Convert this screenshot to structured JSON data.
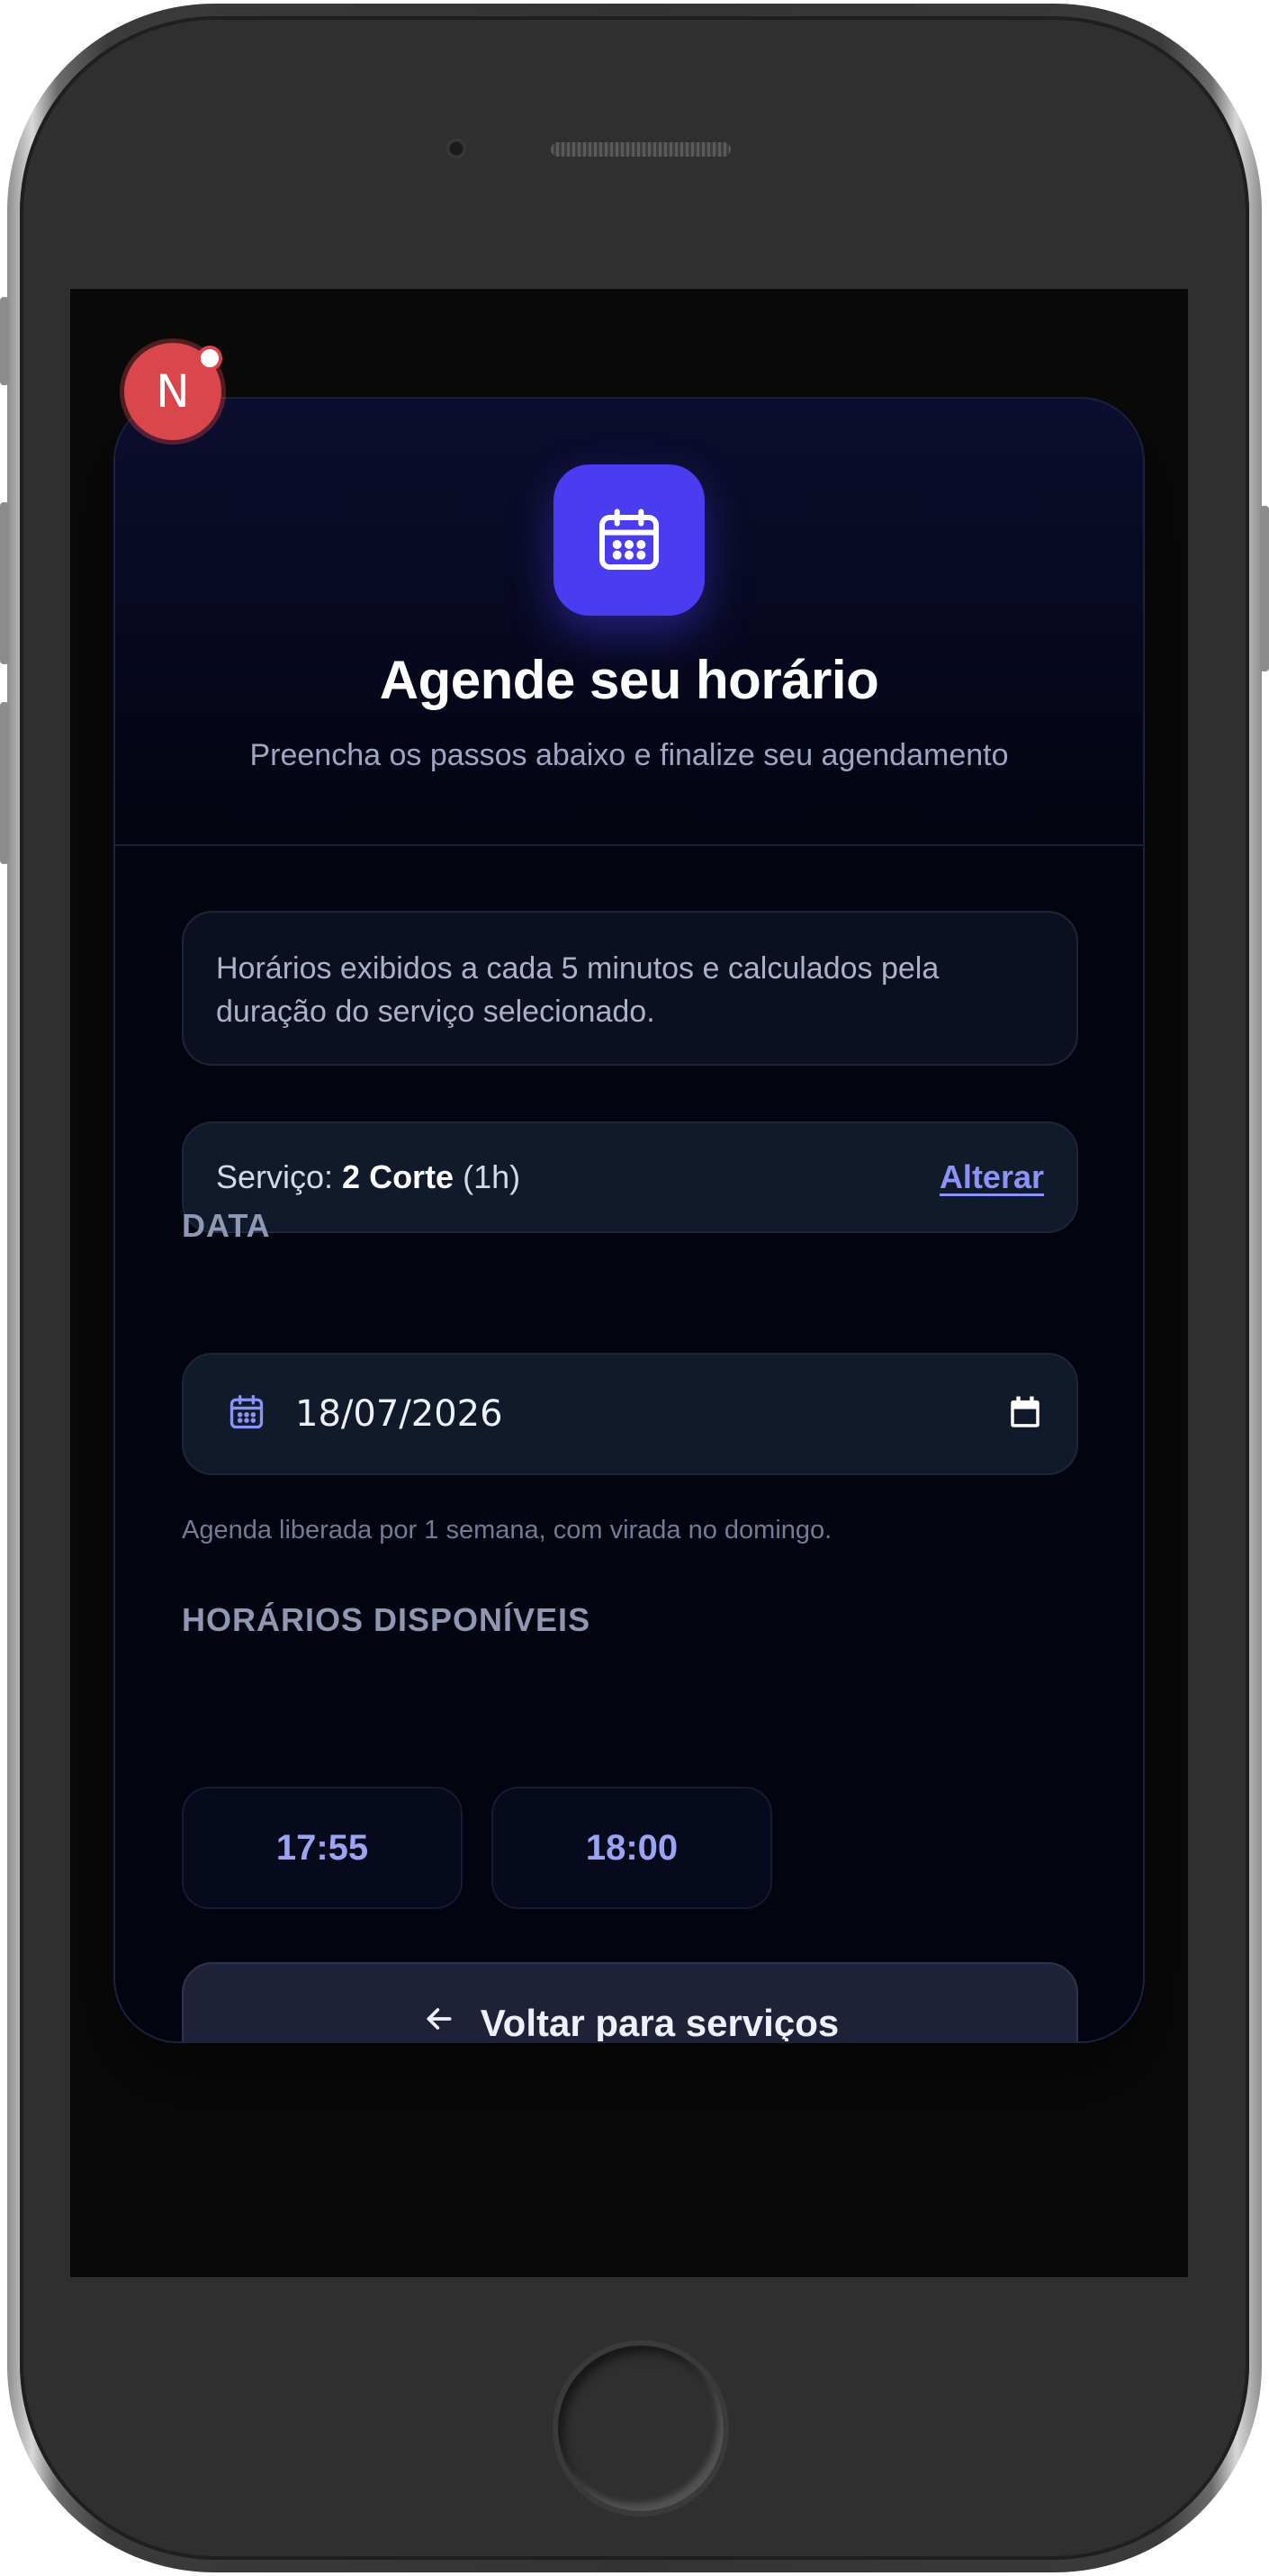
{
  "badge": {
    "letter": "N"
  },
  "header": {
    "title": "Agende seu horário",
    "subtitle": "Preencha os passos abaixo e finalize seu agendamento"
  },
  "info": {
    "text": "Horários exibidos a cada 5 minutos e calculados pela duração do serviço selecionado."
  },
  "service": {
    "prefix": "Serviço: ",
    "name": "2 Corte",
    "duration": " (1h)",
    "change_label": "Alterar"
  },
  "date": {
    "label": "DATA",
    "value": "18/07/2026",
    "hint": "Agenda liberada por 1 semana, com virada no domingo."
  },
  "times": {
    "label": "HORÁRIOS DISPONÍVEIS",
    "slots": [
      "17:55",
      "18:00"
    ]
  },
  "back_button": {
    "label": "Voltar para serviços"
  },
  "colors": {
    "accent": "#4a3cf0",
    "link": "#8b93f6",
    "background": "#02040f"
  }
}
